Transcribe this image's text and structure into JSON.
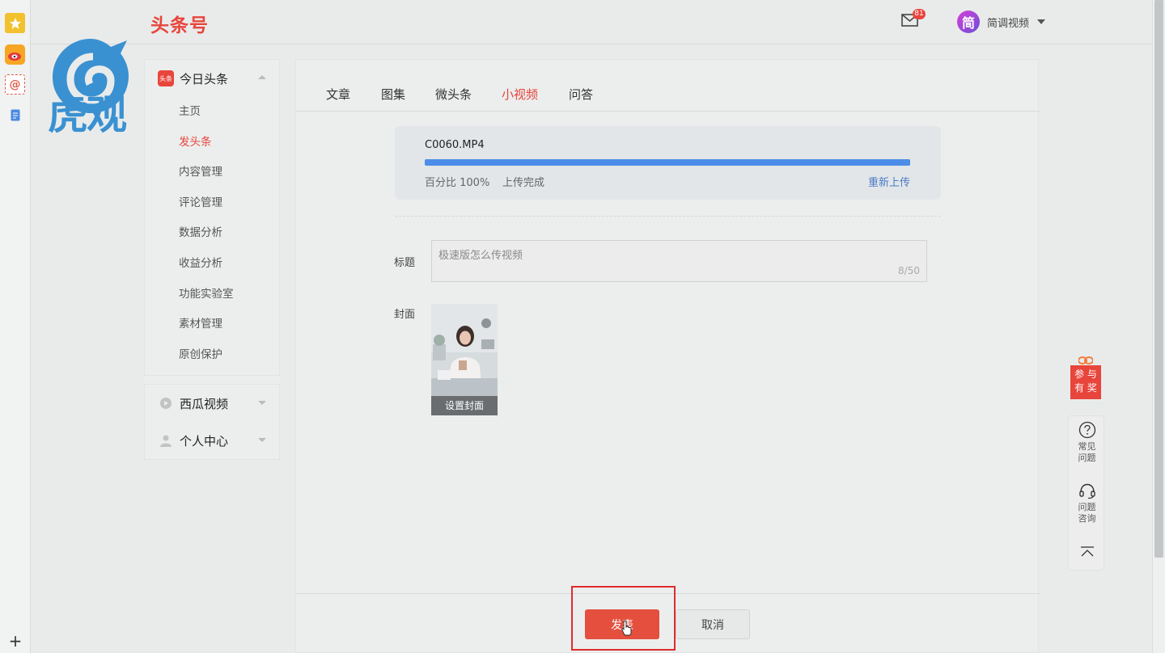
{
  "header": {
    "brand": "头条号",
    "mail_badge": "81",
    "user_name": "简调视频",
    "avatar_char": "简"
  },
  "logo": {
    "text": "虎观"
  },
  "sidebar": {
    "group1": {
      "title": "今日头条",
      "icon_text": "头条",
      "items": [
        {
          "label": "主页"
        },
        {
          "label": "发头条"
        },
        {
          "label": "内容管理"
        },
        {
          "label": "评论管理"
        },
        {
          "label": "数据分析"
        },
        {
          "label": "收益分析"
        },
        {
          "label": "功能实验室"
        },
        {
          "label": "素材管理"
        },
        {
          "label": "原创保护"
        }
      ],
      "active_index": 1
    },
    "group2": {
      "title": "西瓜视频"
    },
    "group3": {
      "title": "个人中心"
    }
  },
  "tabs": [
    {
      "label": "文章"
    },
    {
      "label": "图集"
    },
    {
      "label": "微头条"
    },
    {
      "label": "小视频"
    },
    {
      "label": "问答"
    }
  ],
  "active_tab": 3,
  "upload": {
    "file_name": "C0060.MP4",
    "progress": 1.0,
    "percent_text": "百分比 100%",
    "status_text": "上传完成",
    "reupload_label": "重新上传"
  },
  "form": {
    "title_label": "标题",
    "title_value": "极速版怎么传视频",
    "title_count": "8/50",
    "cover_label": "封面",
    "cover_button": "设置封面"
  },
  "actions": {
    "publish_label": "发表",
    "cancel_label": "取消"
  },
  "float": {
    "gift_line1": "参 与",
    "gift_line2": "有 奖",
    "faq_line1": "常见",
    "faq_line2": "问题",
    "consult_line1": "问题",
    "consult_line2": "咨询"
  },
  "colors": {
    "accent": "#e8453c",
    "progress": "#4d8de8",
    "link": "#4b7bc4",
    "highlight": "#e02b2b"
  }
}
